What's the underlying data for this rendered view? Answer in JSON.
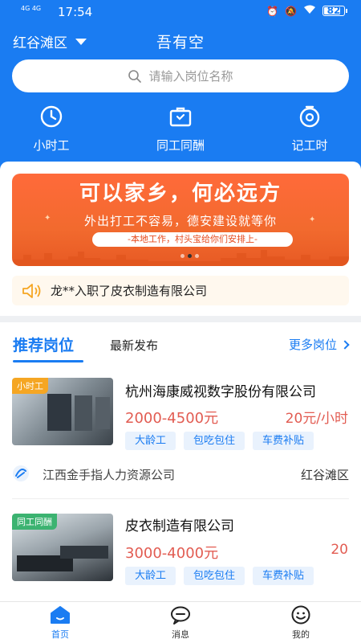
{
  "status_bar": {
    "signal_text": "4G 4G",
    "time": "17:54",
    "battery": "82",
    "battery_level": 0.82
  },
  "header": {
    "region": "红谷滩区",
    "title": "吾有空"
  },
  "search": {
    "placeholder": "请输入岗位名称"
  },
  "categories": [
    {
      "label": "小时工",
      "icon": "clock-icon"
    },
    {
      "label": "同工同酬",
      "icon": "briefcase-icon"
    },
    {
      "label": "记工时",
      "icon": "stopwatch-icon"
    }
  ],
  "banner": {
    "headline": "可以家乡，何必远方",
    "subline": "外出打工不容易，德安建设就等你",
    "pill": "-本地工作，村头宝给你们安排上-",
    "active_slide": 2,
    "slides": 3
  },
  "notice": {
    "text": "龙**入职了皮衣制造有限公司"
  },
  "tabs": {
    "active": "推荐岗位",
    "second": "最新发布",
    "more": "更多岗位"
  },
  "jobs": [
    {
      "badge": "小时工",
      "badge_color": "#f5a623",
      "title": "杭州海康威视数字股份有限公司",
      "salary": "2000-4500元",
      "rate": "20元/小时",
      "tags": [
        "大龄工",
        "包吃包住",
        "车费补贴"
      ],
      "company": "江西金手指人力资源公司",
      "area": "红谷滩区"
    },
    {
      "badge": "同工同酬",
      "badge_color": "#3cb371",
      "title": "皮衣制造有限公司",
      "salary": "3000-4000元",
      "rate": "20",
      "tags": [
        "大龄工",
        "包吃包住",
        "车费补贴"
      ]
    }
  ],
  "bottom_nav": [
    {
      "label": "首页",
      "active": true
    },
    {
      "label": "消息",
      "active": false
    },
    {
      "label": "我的",
      "active": false
    }
  ],
  "colors": {
    "primary": "#1a7cf2",
    "salary": "#e25c52",
    "banner": "#f26a2e"
  }
}
